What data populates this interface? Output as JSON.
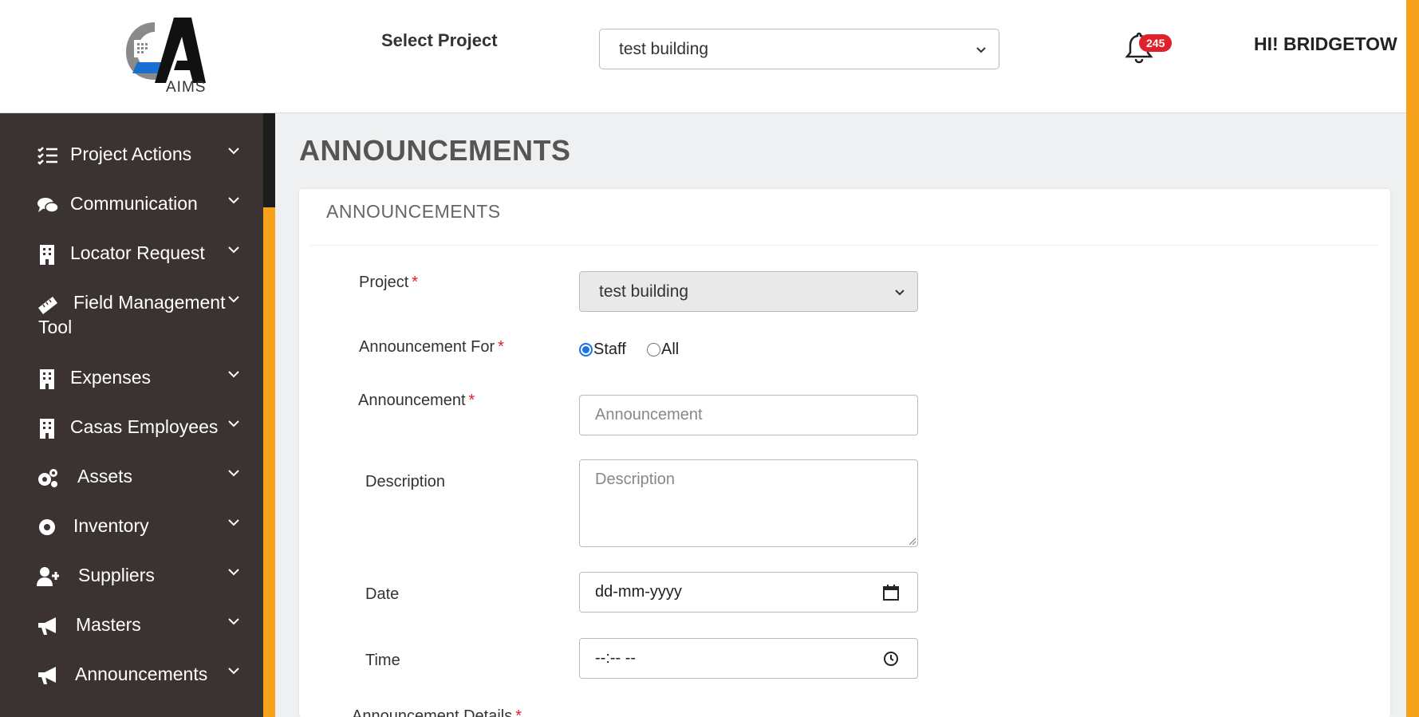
{
  "header": {
    "logo_text": "AIMS",
    "select_label": "Select Project",
    "selected_project": "test building",
    "notification_count": "245",
    "greeting": "HI! BRIDGETOW"
  },
  "sidebar": {
    "items": [
      {
        "label": "Project Actions",
        "icon": "list-check-icon"
      },
      {
        "label": "Communication",
        "icon": "comments-icon"
      },
      {
        "label": "Locator Request",
        "icon": "building-icon"
      },
      {
        "label": "Field Management",
        "label2": "Tool",
        "icon": "ruler-icon"
      },
      {
        "label": "Expenses",
        "icon": "building-icon"
      },
      {
        "label": "Casas Employees",
        "icon": "building-icon"
      },
      {
        "label": "Assets",
        "icon": "gears-icon"
      },
      {
        "label": "Inventory",
        "icon": "gear-icon"
      },
      {
        "label": "Suppliers",
        "icon": "user-plus-icon"
      },
      {
        "label": "Masters",
        "icon": "megaphone-icon"
      },
      {
        "label": "Announcements",
        "icon": "megaphone-icon"
      }
    ]
  },
  "main": {
    "page_title": "ANNOUNCEMENTS",
    "card_title": "ANNOUNCEMENTS",
    "form": {
      "project_label": "Project",
      "project_value": "test building",
      "announcement_for_label": "Announcement For",
      "option_staff": "Staff",
      "option_all": "All",
      "selected_option": "Staff",
      "announcement_label": "Announcement",
      "announcement_placeholder": "Announcement",
      "description_label": "Description",
      "description_placeholder": "Description",
      "date_label": "Date",
      "date_placeholder": "dd-mm-yyyy",
      "time_label": "Time",
      "time_placeholder": "--:-- --",
      "details_label": "Announcement Details",
      "required_mark": "*"
    }
  },
  "colors": {
    "sidebar_bg": "#3a3331",
    "accent_orange": "#f7a21c",
    "badge_red": "#e0202a",
    "logo_blue": "#1a6fd0"
  }
}
